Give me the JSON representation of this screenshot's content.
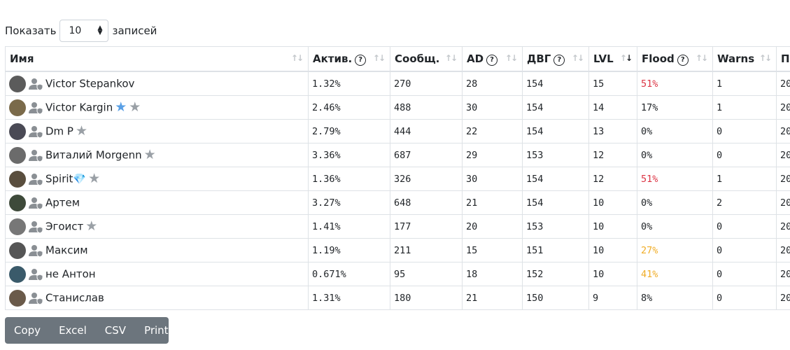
{
  "length": {
    "prefix": "Показать",
    "value": "10",
    "suffix": "записей"
  },
  "headers": [
    "Имя",
    "Актив.",
    "Сообщ.",
    "AD",
    "ДВГ",
    "LVL",
    "Flood",
    "Warns",
    "По"
  ],
  "rows": [
    {
      "name": "Victor Stepankov",
      "stars": [],
      "activity": "1.32%",
      "messages": "270",
      "ad": "28",
      "dvg": "154",
      "lvl": "15",
      "flood": "51%",
      "flood_color": "red",
      "warns": "1",
      "last": "20"
    },
    {
      "name": "Victor Kargin",
      "stars": [
        "blue",
        "gray"
      ],
      "activity": "2.46%",
      "messages": "488",
      "ad": "30",
      "dvg": "154",
      "lvl": "14",
      "flood": "17%",
      "flood_color": "normal",
      "warns": "1",
      "last": "20"
    },
    {
      "name": "Dm P",
      "stars": [
        "gray"
      ],
      "activity": "2.79%",
      "messages": "444",
      "ad": "22",
      "dvg": "154",
      "lvl": "13",
      "flood": "0%",
      "flood_color": "normal",
      "warns": "0",
      "last": "20"
    },
    {
      "name": "Виталий Morgenn",
      "stars": [
        "gray"
      ],
      "activity": "3.36%",
      "messages": "687",
      "ad": "29",
      "dvg": "153",
      "lvl": "12",
      "flood": "0%",
      "flood_color": "normal",
      "warns": "0",
      "last": "20"
    },
    {
      "name": "Spirit💎",
      "stars": [
        "gray"
      ],
      "activity": "1.36%",
      "messages": "326",
      "ad": "30",
      "dvg": "154",
      "lvl": "12",
      "flood": "51%",
      "flood_color": "red",
      "warns": "1",
      "last": "20"
    },
    {
      "name": "Артем",
      "stars": [],
      "activity": "3.27%",
      "messages": "648",
      "ad": "21",
      "dvg": "154",
      "lvl": "10",
      "flood": "0%",
      "flood_color": "normal",
      "warns": "2",
      "last": "20"
    },
    {
      "name": "Эгоист",
      "stars": [
        "gray"
      ],
      "activity": "1.41%",
      "messages": "177",
      "ad": "20",
      "dvg": "153",
      "lvl": "10",
      "flood": "0%",
      "flood_color": "normal",
      "warns": "0",
      "last": "20"
    },
    {
      "name": "Максим",
      "stars": [],
      "activity": "1.19%",
      "messages": "211",
      "ad": "15",
      "dvg": "151",
      "lvl": "10",
      "flood": "27%",
      "flood_color": "orange",
      "warns": "0",
      "last": "20"
    },
    {
      "name": "не Антон",
      "stars": [],
      "activity": "0.671%",
      "messages": "95",
      "ad": "18",
      "dvg": "152",
      "lvl": "10",
      "flood": "41%",
      "flood_color": "orange",
      "warns": "0",
      "last": "20"
    },
    {
      "name": "Станислав",
      "stars": [],
      "activity": "1.31%",
      "messages": "180",
      "ad": "21",
      "dvg": "150",
      "lvl": "9",
      "flood": "8%",
      "flood_color": "normal",
      "warns": "0",
      "last": "20"
    }
  ],
  "avatar_colors": [
    "#5b5b5b",
    "#7a6a4a",
    "#4a4a55",
    "#6b6b6b",
    "#5a4e3e",
    "#3e4a3a",
    "#777777",
    "#555555",
    "#3a5a6a",
    "#6a5a4a"
  ],
  "buttons": [
    "Copy",
    "Excel",
    "CSV",
    "Print"
  ],
  "colors": {
    "red": "#dc3545",
    "orange": "#f0ad28",
    "blue_star": "#5aa0e6",
    "gray_star": "#9aa0a6",
    "button_bg": "#6c757d"
  }
}
